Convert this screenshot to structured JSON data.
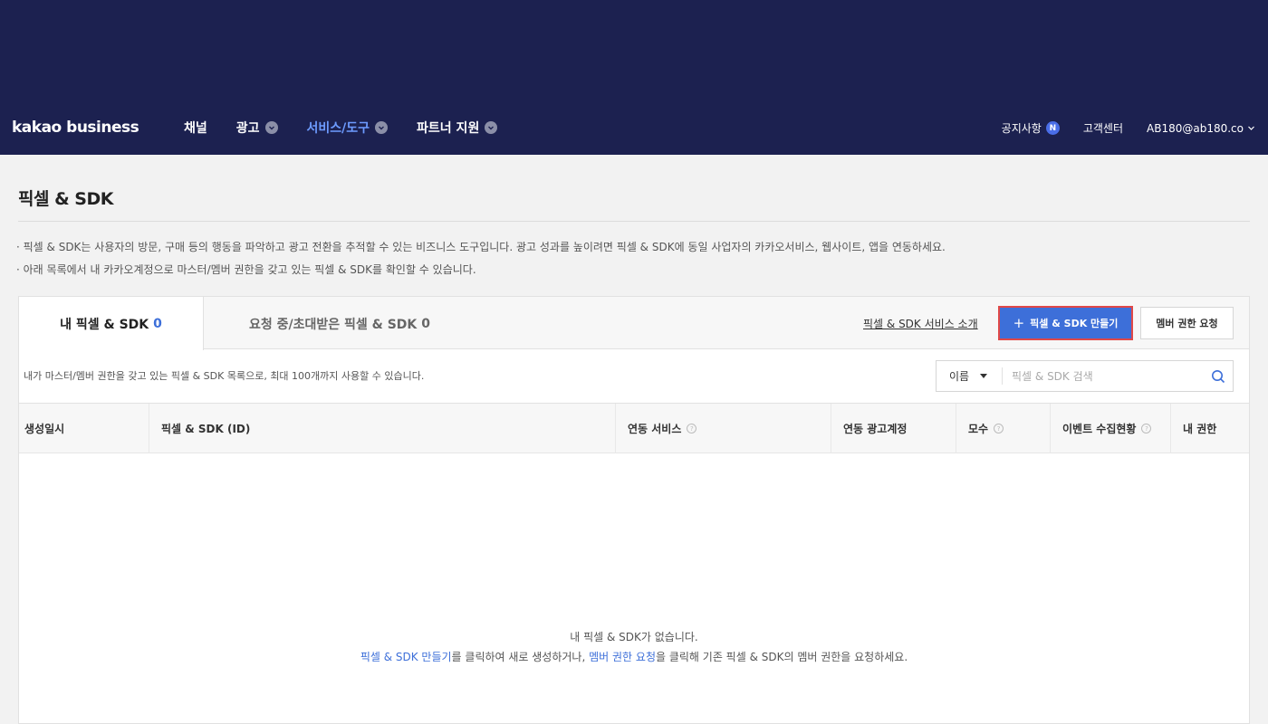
{
  "header": {
    "logo": "kakao business",
    "nav": [
      {
        "label": "채널",
        "has_dropdown": false,
        "active": false
      },
      {
        "label": "광고",
        "has_dropdown": true,
        "active": false
      },
      {
        "label": "서비스/도구",
        "has_dropdown": true,
        "active": true
      },
      {
        "label": "파트너 지원",
        "has_dropdown": true,
        "active": false
      }
    ],
    "notice": "공지사항",
    "notice_badge": "N",
    "support": "고객센터",
    "account": "AB180@ab180.co"
  },
  "page": {
    "title": "픽셀 & SDK",
    "desc1": "· 픽셀 & SDK는 사용자의 방문, 구매 등의 행동을 파악하고 광고 전환을 추적할 수 있는 비즈니스 도구입니다. 광고 성과를 높이려면 픽셀 & SDK에 동일 사업자의 카카오서비스, 웹사이트, 앱을 연동하세요.",
    "desc2": "· 아래 목록에서 내 카카오계정으로 마스터/멤버 권한을 갖고 있는 픽셀 & SDK를 확인할 수 있습니다."
  },
  "tabs": {
    "mine_label": "내 픽셀 & SDK",
    "mine_count": "0",
    "pending_label": "요청 중/초대받은 픽셀 & SDK",
    "pending_count": "0"
  },
  "actions": {
    "intro_link": "픽셀 & SDK 서비스 소개",
    "create_button": "픽셀 & SDK 만들기",
    "member_button": "멤버 권한 요청"
  },
  "list": {
    "description": "내가 마스터/멤버 권한을 갖고 있는 픽셀 & SDK 목록으로, 최대 100개까지 사용할 수 있습니다.",
    "search_filter": "이름",
    "search_placeholder": "픽셀 & SDK 검색"
  },
  "table": {
    "columns": [
      {
        "label": "생성일시",
        "help": false
      },
      {
        "label": "픽셀 & SDK (ID)",
        "help": false
      },
      {
        "label": "연동 서비스",
        "help": true
      },
      {
        "label": "연동 광고계정",
        "help": false
      },
      {
        "label": "모수",
        "help": true
      },
      {
        "label": "이벤트 수집현황",
        "help": true
      },
      {
        "label": "내 권한",
        "help": false
      }
    ],
    "help_glyph": "?"
  },
  "empty": {
    "line1": "내 픽셀 & SDK가 없습니다.",
    "link_create": "픽셀 & SDK 만들기",
    "text_mid": "를 클릭하여 새로 생성하거나, ",
    "link_member": "멤버 권한 요청",
    "text_end": "을 클릭해 기존 픽셀 & SDK의 멤버 권한을 요청하세요."
  },
  "colors": {
    "header_bg": "#1c2150",
    "accent": "#3d6fd9",
    "highlight_border": "#e04848"
  }
}
